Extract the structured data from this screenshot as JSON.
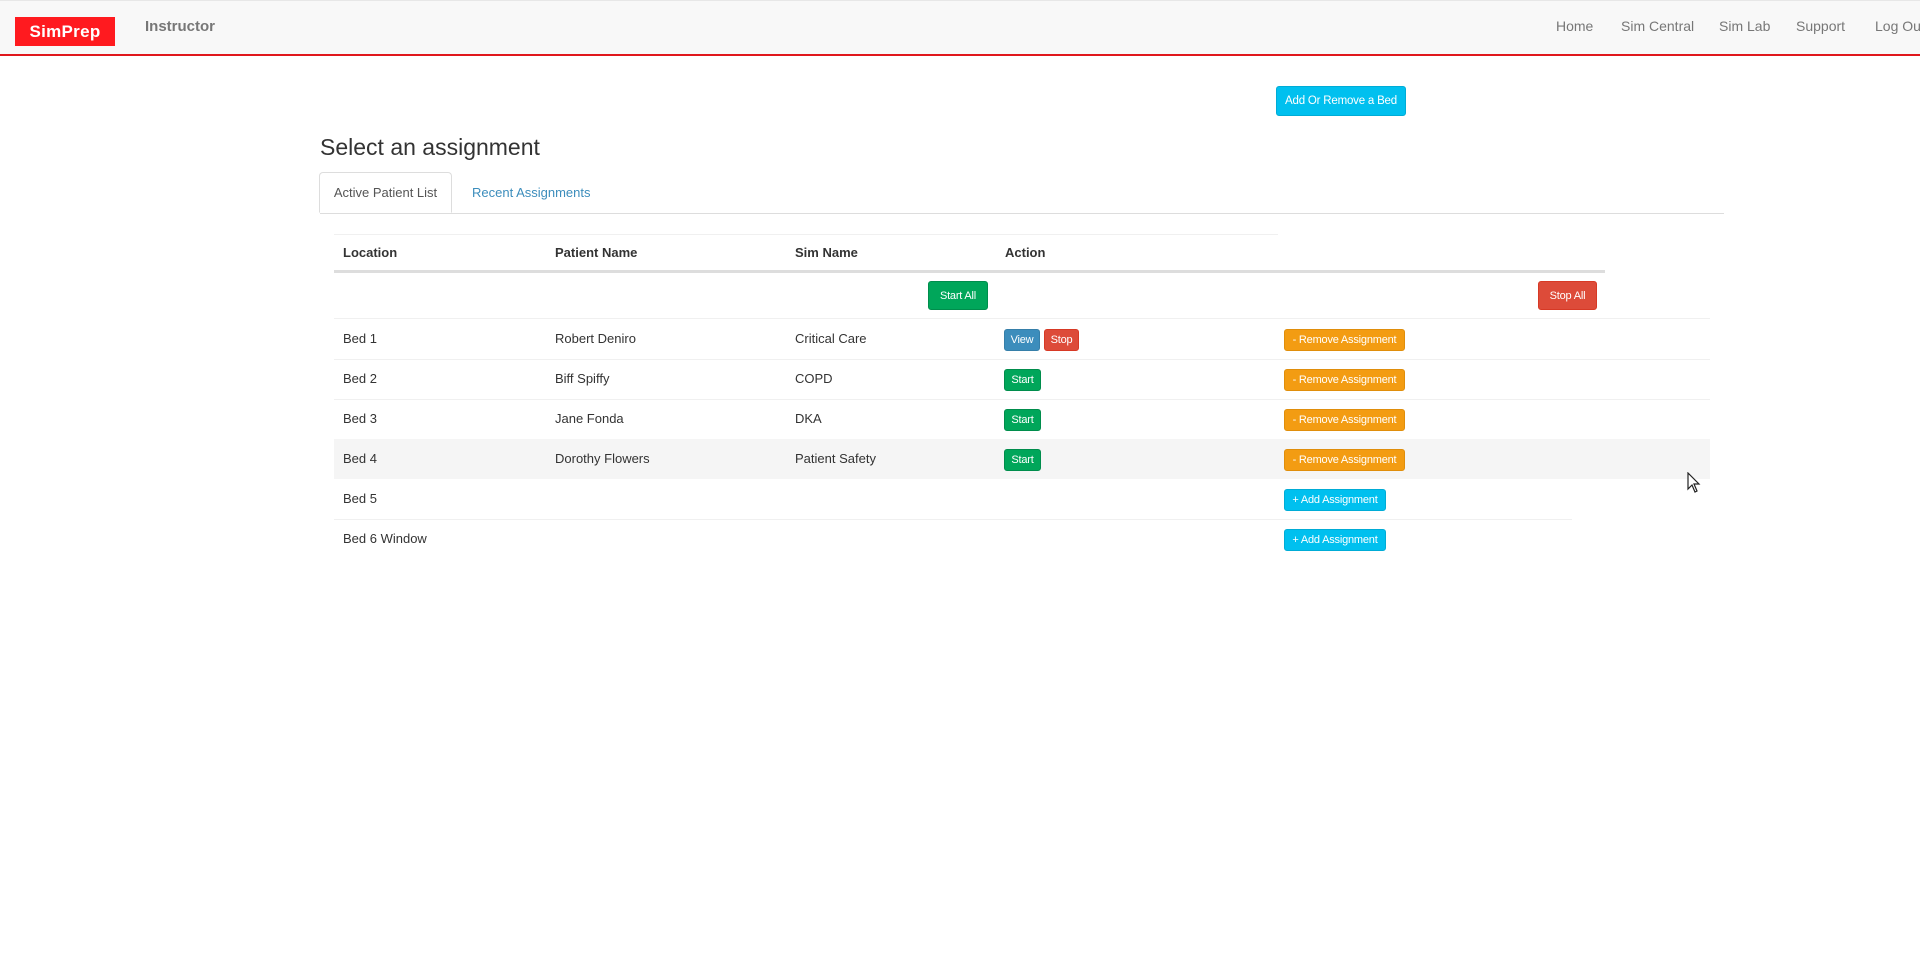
{
  "navbar": {
    "logo": "SimPrep",
    "role": "Instructor",
    "links": [
      "Home",
      "Sim Central",
      "Sim Lab",
      "Support",
      "Log Out"
    ],
    "accent_color": "#e0171c"
  },
  "page": {
    "add_remove_bed_label": "Add Or Remove a Bed",
    "heading": "Select an assignment",
    "tabs": [
      {
        "label": "Active Patient List",
        "active": true
      },
      {
        "label": "Recent Assignments",
        "active": false
      }
    ]
  },
  "table": {
    "headers": [
      "Location",
      "Patient Name",
      "Sim Name",
      "Action"
    ],
    "start_all_label": "Start All",
    "stop_all_label": "Stop All",
    "rows": [
      {
        "location": "Bed 1",
        "patient": "Robert Deniro",
        "sim": "Critical Care",
        "actions": [
          "View",
          "Stop"
        ],
        "assignment_action": "- Remove Assignment"
      },
      {
        "location": "Bed 2",
        "patient": "Biff Spiffy",
        "sim": "COPD",
        "actions": [
          "Start"
        ],
        "assignment_action": "- Remove Assignment"
      },
      {
        "location": "Bed 3",
        "patient": "Jane Fonda",
        "sim": "DKA",
        "actions": [
          "Start"
        ],
        "assignment_action": "- Remove Assignment"
      },
      {
        "location": "Bed 4",
        "patient": "Dorothy Flowers",
        "sim": "Patient Safety",
        "actions": [
          "Start"
        ],
        "assignment_action": "- Remove Assignment"
      },
      {
        "location": "Bed 5",
        "patient": "",
        "sim": "",
        "actions": [],
        "assignment_action": "+ Add Assignment"
      },
      {
        "location": "Bed 6 Window",
        "patient": "",
        "sim": "",
        "actions": [],
        "assignment_action": "+ Add Assignment"
      }
    ]
  }
}
